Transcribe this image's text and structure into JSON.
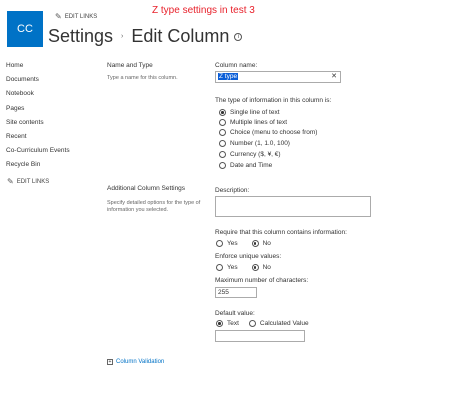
{
  "site": {
    "logo_text": "CC"
  },
  "annotation": "Z type settings in test 3",
  "header": {
    "edit_links": "EDIT LINKS",
    "breadcrumb_root": "Settings",
    "separator": "›",
    "page_title": "Edit Column",
    "info_glyph": "i"
  },
  "quicklaunch": {
    "items": [
      {
        "label": "Home"
      },
      {
        "label": "Documents"
      },
      {
        "label": "Notebook"
      },
      {
        "label": "Pages"
      },
      {
        "label": "Site contents"
      },
      {
        "label": "Recent"
      },
      {
        "label": "Co-Curriculum Events"
      },
      {
        "label": "Recycle Bin"
      }
    ],
    "edit_links": "EDIT LINKS"
  },
  "name_and_type": {
    "heading": "Name and Type",
    "description": "Type a name for this column.",
    "column_name_label": "Column name:",
    "column_name_value": "Z type",
    "clear_glyph": "✕",
    "type_label": "The type of information in this column is:",
    "type_options": [
      {
        "label": "Single line of text",
        "checked": true
      },
      {
        "label": "Multiple lines of text",
        "checked": false
      },
      {
        "label": "Choice (menu to choose from)",
        "checked": false
      },
      {
        "label": "Number (1, 1.0, 100)",
        "checked": false
      },
      {
        "label": "Currency ($, ¥, €)",
        "checked": false
      },
      {
        "label": "Date and Time",
        "checked": false
      }
    ]
  },
  "additional": {
    "heading": "Additional Column Settings",
    "description": "Specify detailed options for the type of information you selected.",
    "description_label": "Description:",
    "description_value": "",
    "require_label": "Require that this column contains information:",
    "require_yes": "Yes",
    "require_no": "No",
    "require_selected": "No",
    "unique_label": "Enforce unique values:",
    "unique_yes": "Yes",
    "unique_no": "No",
    "unique_selected": "No",
    "max_chars_label": "Maximum number of characters:",
    "max_chars_value": "255",
    "default_label": "Default value:",
    "default_text": "Text",
    "default_calc": "Calculated Value",
    "default_selected": "Text",
    "default_value": ""
  },
  "column_validation": {
    "label": "Column Validation",
    "expand_glyph": "+"
  },
  "icons": {
    "pencil": "pencil-icon",
    "info": "info-icon",
    "expand": "expand-icon"
  },
  "colors": {
    "logo_bg": "#0072c6",
    "annotation": "#e8212b",
    "link": "#0072c6",
    "selection": "#0b5ed7"
  }
}
